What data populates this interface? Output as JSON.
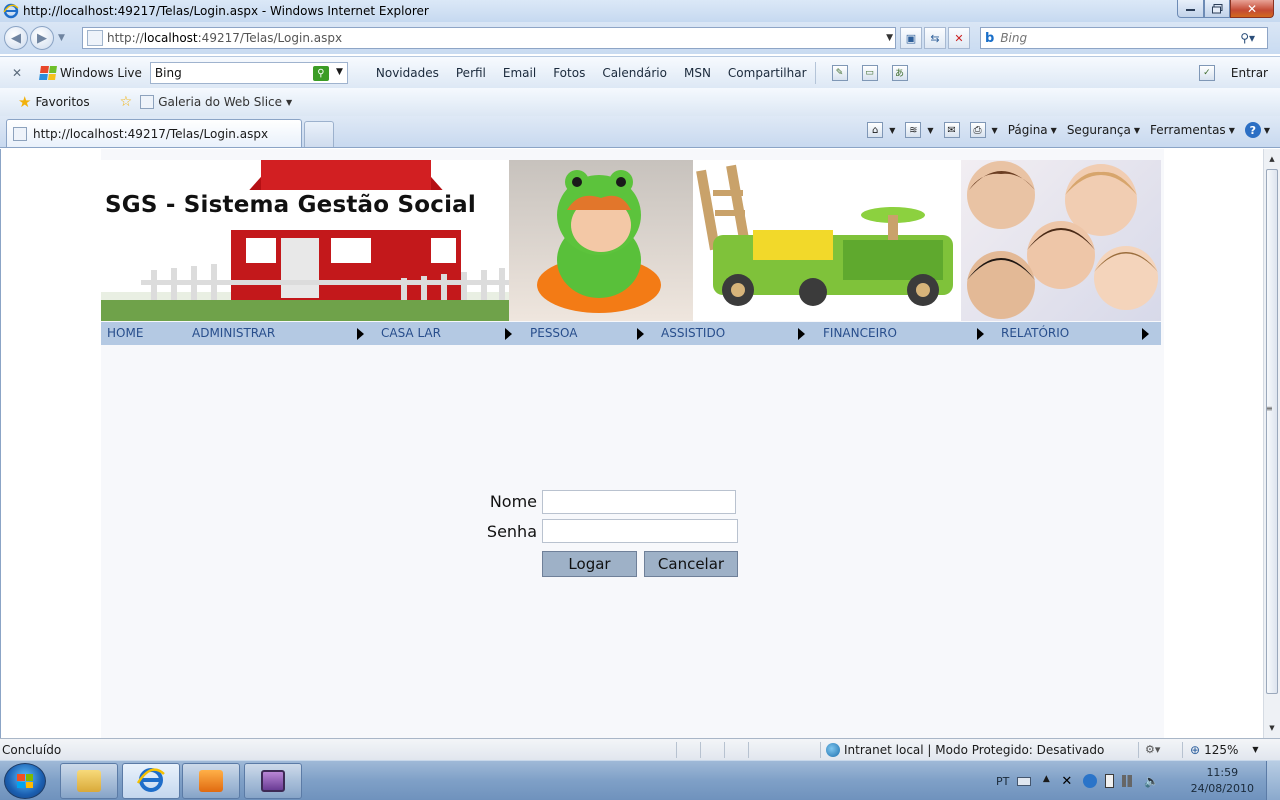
{
  "window": {
    "title": "http://localhost:49217/Telas/Login.aspx - Windows Internet Explorer",
    "close_glyph": "✕"
  },
  "address_bar": {
    "url_prefix": "http://",
    "url_host": "localhost",
    "url_rest": ":49217/Telas/Login.aspx"
  },
  "search_bar": {
    "placeholder": "Bing"
  },
  "windows_live": {
    "label": "Windows Live",
    "search_value": "Bing",
    "links": [
      "Novidades",
      "Perfil",
      "Email",
      "Fotos",
      "Calendário",
      "MSN",
      "Compartilhar"
    ],
    "sign_in": "Entrar"
  },
  "favorites": {
    "label": "Favoritos",
    "gallery": "Galeria do Web Slice"
  },
  "tab": {
    "label": "http://localhost:49217/Telas/Login.aspx"
  },
  "command_bar": {
    "page": "Página",
    "safety": "Segurança",
    "tools": "Ferramentas",
    "help": "?"
  },
  "site": {
    "banner_title": "SGS - Sistema Gestão Social",
    "menu": [
      "HOME",
      "ADMINISTRAR",
      "CASA LAR",
      "PESSOA",
      "ASSISTIDO",
      "FINANCEIRO",
      "RELATÓRIO"
    ]
  },
  "login": {
    "name_label": "Nome",
    "password_label": "Senha",
    "name_value": "",
    "password_value": "",
    "login_button": "Logar",
    "cancel_button": "Cancelar"
  },
  "status": {
    "text": "Concluído",
    "zone": "Intranet local | Modo Protegido: Desativado",
    "zoom": "125%"
  },
  "taskbar": {
    "language": "PT",
    "time": "11:59",
    "date": "24/08/2010"
  }
}
